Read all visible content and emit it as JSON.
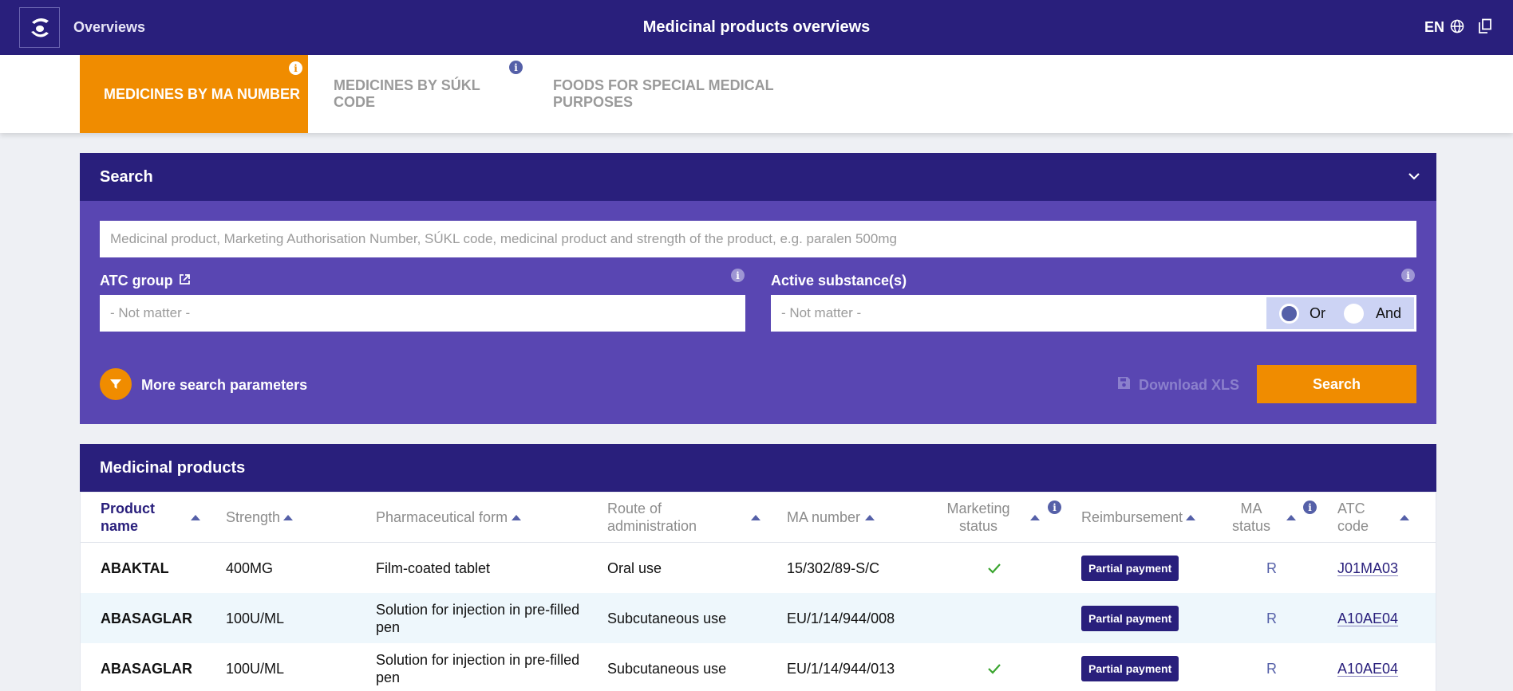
{
  "header": {
    "nav_link": "Overviews",
    "title": "Medicinal products overviews",
    "language": "EN",
    "icons": [
      "logo-icon",
      "globe-icon",
      "copy-icon"
    ]
  },
  "tabs": [
    {
      "label": "MEDICINES BY MA NUMBER",
      "active": true
    },
    {
      "label": "MEDICINES BY SÚKL CODE",
      "active": false
    },
    {
      "label": "FOODS FOR SPECIAL MEDICAL PURPOSES",
      "active": false
    }
  ],
  "search": {
    "title": "Search",
    "placeholder": "Medicinal product, Marketing Authorisation Number, SÚKL code, medicinal product and strength of the product, e.g. paralen 500mg",
    "atc_label": "ATC group",
    "atc_value": "- Not matter -",
    "substance_label": "Active substance(s)",
    "substance_value": "- Not matter -",
    "logic_or": "Or",
    "logic_and": "And",
    "logic_selected": "Or",
    "more_params": "More search parameters",
    "download": "Download XLS",
    "button": "Search"
  },
  "results": {
    "title": "Medicinal products",
    "columns": [
      "Product name",
      "Strength",
      "Pharmaceutical form",
      "Route of administration",
      "MA number",
      "Marketing status",
      "Reimbursement",
      "MA status",
      "ATC code"
    ],
    "rows": [
      {
        "name": "ABAKTAL",
        "strength": "400MG",
        "form": "Film-coated tablet",
        "route": "Oral use",
        "ma_number": "15/302/89-S/C",
        "marketing_status": "marketed",
        "reimbursement": "Partial payment",
        "ma_status": "R",
        "atc": "J01MA03"
      },
      {
        "name": "ABASAGLAR",
        "strength": "100U/ML",
        "form": "Solution for injection in pre-filled pen",
        "route": "Subcutaneous use",
        "ma_number": "EU/1/14/944/008",
        "marketing_status": "",
        "reimbursement": "Partial payment",
        "ma_status": "R",
        "atc": "A10AE04"
      },
      {
        "name": "ABASAGLAR",
        "strength": "100U/ML",
        "form": "Solution for injection in pre-filled pen",
        "route": "Subcutaneous use",
        "ma_number": "EU/1/14/944/013",
        "marketing_status": "marketed",
        "reimbursement": "Partial payment",
        "ma_status": "R",
        "atc": "A10AE04"
      }
    ]
  },
  "colors": {
    "header": "#291f7c",
    "panel": "#5946b2",
    "accent": "#f08c00",
    "check": "#3aa52f"
  }
}
